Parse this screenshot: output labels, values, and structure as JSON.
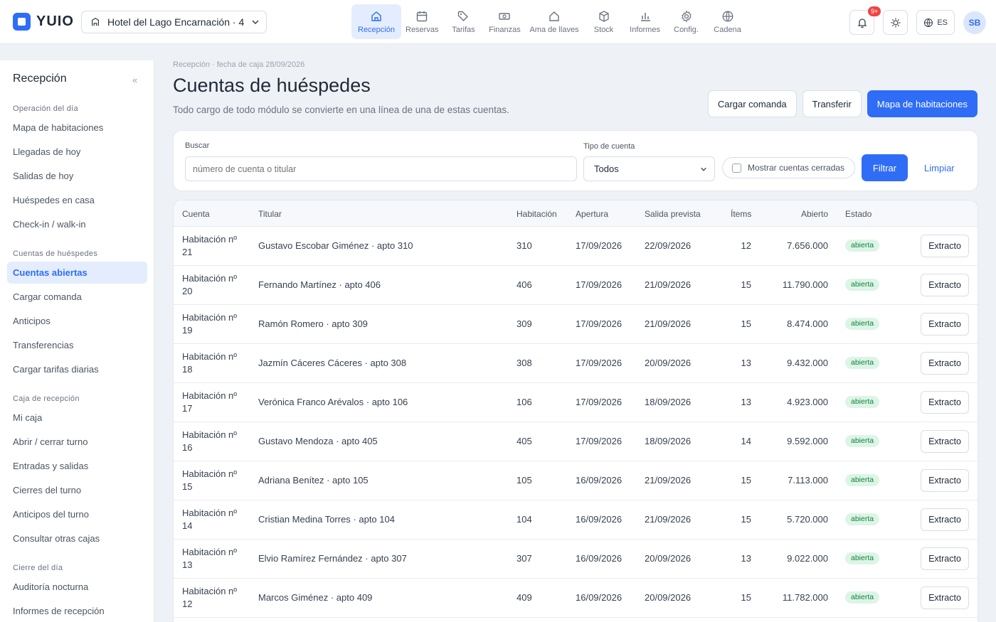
{
  "app": {
    "brand": "YUIO",
    "hotel": "Hotel del Lago Encarnación · 4"
  },
  "nav": [
    {
      "label": "Recepción",
      "icon": "home-icon",
      "active": true
    },
    {
      "label": "Reservas",
      "icon": "calendar-icon"
    },
    {
      "label": "Tarifas",
      "icon": "tag-icon"
    },
    {
      "label": "Finanzas",
      "icon": "money-icon"
    },
    {
      "label": "Ama de llaves",
      "icon": "house-icon"
    },
    {
      "label": "Stock",
      "icon": "box-icon"
    },
    {
      "label": "Informes",
      "icon": "bar-chart-icon"
    },
    {
      "label": "Config.",
      "icon": "gear-icon"
    },
    {
      "label": "Cadena",
      "icon": "globe-icon"
    }
  ],
  "topright": {
    "notif_badge": "9+",
    "lang": "ES",
    "avatar": "SB"
  },
  "sidebar": {
    "title": "Recepción",
    "collapse": "«",
    "groups": [
      {
        "label": "Operación del día",
        "items": [
          "Mapa de habitaciones",
          "Llegadas de hoy",
          "Salidas de hoy",
          "Huéspedes en casa",
          "Check-in / walk-in"
        ]
      },
      {
        "label": "Cuentas de huéspedes",
        "items": [
          "Cuentas abiertas",
          "Cargar comanda",
          "Anticipos",
          "Transferencias",
          "Cargar tarifas diarias"
        ]
      },
      {
        "label": "Caja de recepción",
        "items": [
          "Mi caja",
          "Abrir / cerrar turno",
          "Entradas y salidas",
          "Cierres del turno",
          "Anticipos del turno",
          "Consultar otras cajas"
        ]
      },
      {
        "label": "Cierre del día",
        "items": [
          "Auditoría nocturna",
          "Informes de recepción"
        ]
      }
    ],
    "active_item": "Cuentas abiertas"
  },
  "page": {
    "breadcrumb": "Recepción · fecha de caja 28/09/2026",
    "title": "Cuentas de huéspedes",
    "subtitle": "Todo cargo de todo módulo se convierte en una línea de una de estas cuentas.",
    "actions": {
      "load": "Cargar comanda",
      "transfer": "Transferir",
      "map": "Mapa de habitaciones"
    }
  },
  "filters": {
    "search_label": "Buscar",
    "search_placeholder": "número de cuenta o titular",
    "type_label": "Tipo de cuenta",
    "type_value": "Todos",
    "closed_label": "Mostrar cuentas cerradas",
    "filter": "Filtrar",
    "clear": "Limpiar"
  },
  "table": {
    "headers": {
      "account": "Cuenta",
      "holder": "Titular",
      "room": "Habitación",
      "opened": "Apertura",
      "checkout": "Salida prevista",
      "items": "Ítems",
      "open": "Abierto",
      "status": "Estado"
    },
    "row_button": "Extracto",
    "rows": [
      {
        "account": "Habitación nº 21",
        "holder": "Gustavo Escobar Giménez · apto 310",
        "room": "310",
        "opened": "17/09/2026",
        "checkout": "22/09/2026",
        "items": "12",
        "open": "7.656.000",
        "status": "abierta"
      },
      {
        "account": "Habitación nº 20",
        "holder": "Fernando Martínez · apto 406",
        "room": "406",
        "opened": "17/09/2026",
        "checkout": "21/09/2026",
        "items": "15",
        "open": "11.790.000",
        "status": "abierta"
      },
      {
        "account": "Habitación nº 19",
        "holder": "Ramón Romero · apto 309",
        "room": "309",
        "opened": "17/09/2026",
        "checkout": "21/09/2026",
        "items": "15",
        "open": "8.474.000",
        "status": "abierta"
      },
      {
        "account": "Habitación nº 18",
        "holder": "Jazmín Cáceres Cáceres · apto 308",
        "room": "308",
        "opened": "17/09/2026",
        "checkout": "20/09/2026",
        "items": "13",
        "open": "9.432.000",
        "status": "abierta"
      },
      {
        "account": "Habitación nº 17",
        "holder": "Verónica Franco Arévalos · apto 106",
        "room": "106",
        "opened": "17/09/2026",
        "checkout": "18/09/2026",
        "items": "13",
        "open": "4.923.000",
        "status": "abierta"
      },
      {
        "account": "Habitación nº 16",
        "holder": "Gustavo Mendoza · apto 405",
        "room": "405",
        "opened": "17/09/2026",
        "checkout": "18/09/2026",
        "items": "14",
        "open": "9.592.000",
        "status": "abierta"
      },
      {
        "account": "Habitación nº 15",
        "holder": "Adriana Benítez · apto 105",
        "room": "105",
        "opened": "16/09/2026",
        "checkout": "21/09/2026",
        "items": "15",
        "open": "7.113.000",
        "status": "abierta"
      },
      {
        "account": "Habitación nº 14",
        "holder": "Cristian Medina Torres · apto 104",
        "room": "104",
        "opened": "16/09/2026",
        "checkout": "21/09/2026",
        "items": "15",
        "open": "5.720.000",
        "status": "abierta"
      },
      {
        "account": "Habitación nº 13",
        "holder": "Elvio Ramírez Fernández · apto 307",
        "room": "307",
        "opened": "16/09/2026",
        "checkout": "20/09/2026",
        "items": "13",
        "open": "9.022.000",
        "status": "abierta"
      },
      {
        "account": "Habitación nº 12",
        "holder": "Marcos Giménez · apto 409",
        "room": "409",
        "opened": "16/09/2026",
        "checkout": "20/09/2026",
        "items": "15",
        "open": "11.782.000",
        "status": "abierta"
      }
    ]
  },
  "colors": {
    "accent": "#2f6df6",
    "accent_soft": "#e3edfd",
    "status_open_bg": "#dcf5e6",
    "status_open_fg": "#15803d",
    "badge": "#ef4444"
  }
}
